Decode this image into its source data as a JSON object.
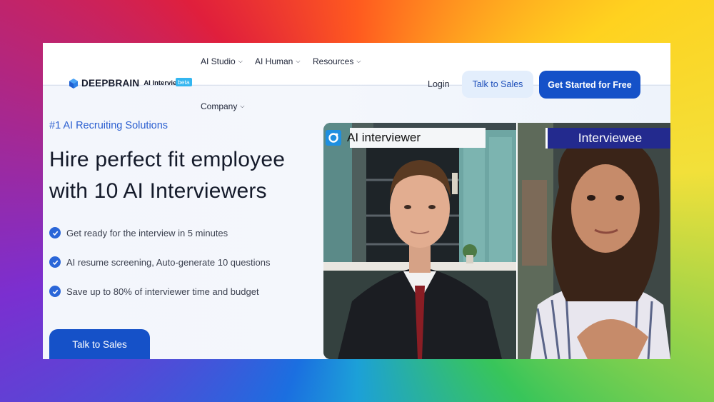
{
  "brand": {
    "name": "DEEPBRAIN",
    "product": "AI Interview",
    "badge": "beta"
  },
  "nav": {
    "menus": [
      {
        "label": "AI Studio"
      },
      {
        "label": "AI Human"
      },
      {
        "label": "Resources"
      },
      {
        "label": "Company"
      }
    ],
    "login": "Login",
    "talk_to_sales": "Talk to Sales",
    "get_started": "Get Started for Free"
  },
  "hero": {
    "tagline": "#1 AI Recruiting Solutions",
    "headline_line1": "Hire perfect fit employee",
    "headline_line2": "with 10 AI Interviewers",
    "benefits": [
      "Get ready for the interview in 5 minutes",
      "AI resume screening, Auto-generate 10 questions",
      "Save up to 80% of interviewer time and budget"
    ],
    "cta": "Talk to Sales"
  },
  "video": {
    "left_label": "AI interviewer",
    "right_label": "Interviewee"
  },
  "colors": {
    "primary": "#1551c8",
    "tagline": "#2b5fd0",
    "interviewee_label_bg": "#232a8e"
  }
}
